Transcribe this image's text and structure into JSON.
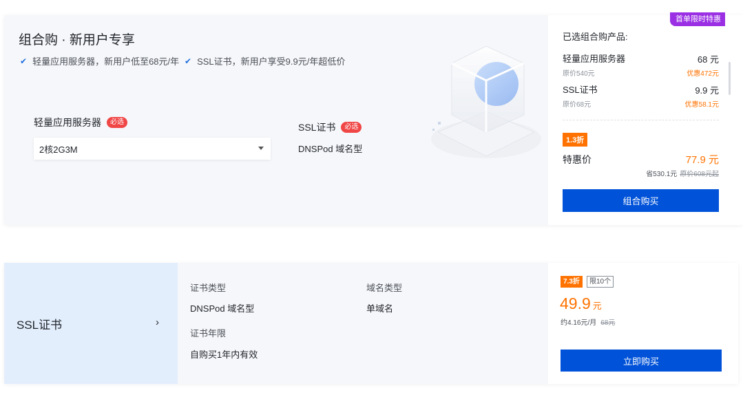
{
  "combo": {
    "title": "组合购 · 新用户专享",
    "features": [
      "轻量应用服务器，新用户低至68元/年",
      "SSL证书，新用户享受9.9元/年超低价"
    ],
    "server": {
      "label": "轻量应用服务器",
      "required": "必选",
      "selected": "2核2G3M"
    },
    "ssl": {
      "label": "SSL证书",
      "required": "必选",
      "value": "DNSPod 域名型"
    },
    "summary": {
      "promo_badge": "首单限时特惠",
      "title": "已选组合购产品:",
      "items": [
        {
          "name": "轻量应用服务器",
          "price": "68 元",
          "original": "原价540元",
          "discount": "优惠472元"
        },
        {
          "name": "SSL证书",
          "price": "9.9 元",
          "original": "原价68元",
          "discount": "优惠58.1元"
        }
      ],
      "rate_badge": "1.3折",
      "deal_label": "特惠价",
      "deal_price": "77.9 元",
      "saved": "省530.1元",
      "original_total": "原价608元起",
      "buy_label": "组合购买"
    }
  },
  "ssl_card": {
    "title": "SSL证书",
    "chevron": "›",
    "attrs": {
      "type_label": "证书类型",
      "type_value": "DNSPod 域名型",
      "domain_label": "域名类型",
      "domain_value": "单域名",
      "term_label": "证书年限",
      "term_value": "自购买1年内有效"
    },
    "rate_badge": "7.3折",
    "limit_badge": "限10个",
    "price": "49.9",
    "unit": "元",
    "monthly": "约4.16元/月",
    "original": "68元",
    "buy_label": "立即购买"
  },
  "colors": {
    "accent_blue": "#0052d9",
    "orange": "#ff7200",
    "promo_purple": "#9a2fe3",
    "required_red": "#f04646"
  }
}
